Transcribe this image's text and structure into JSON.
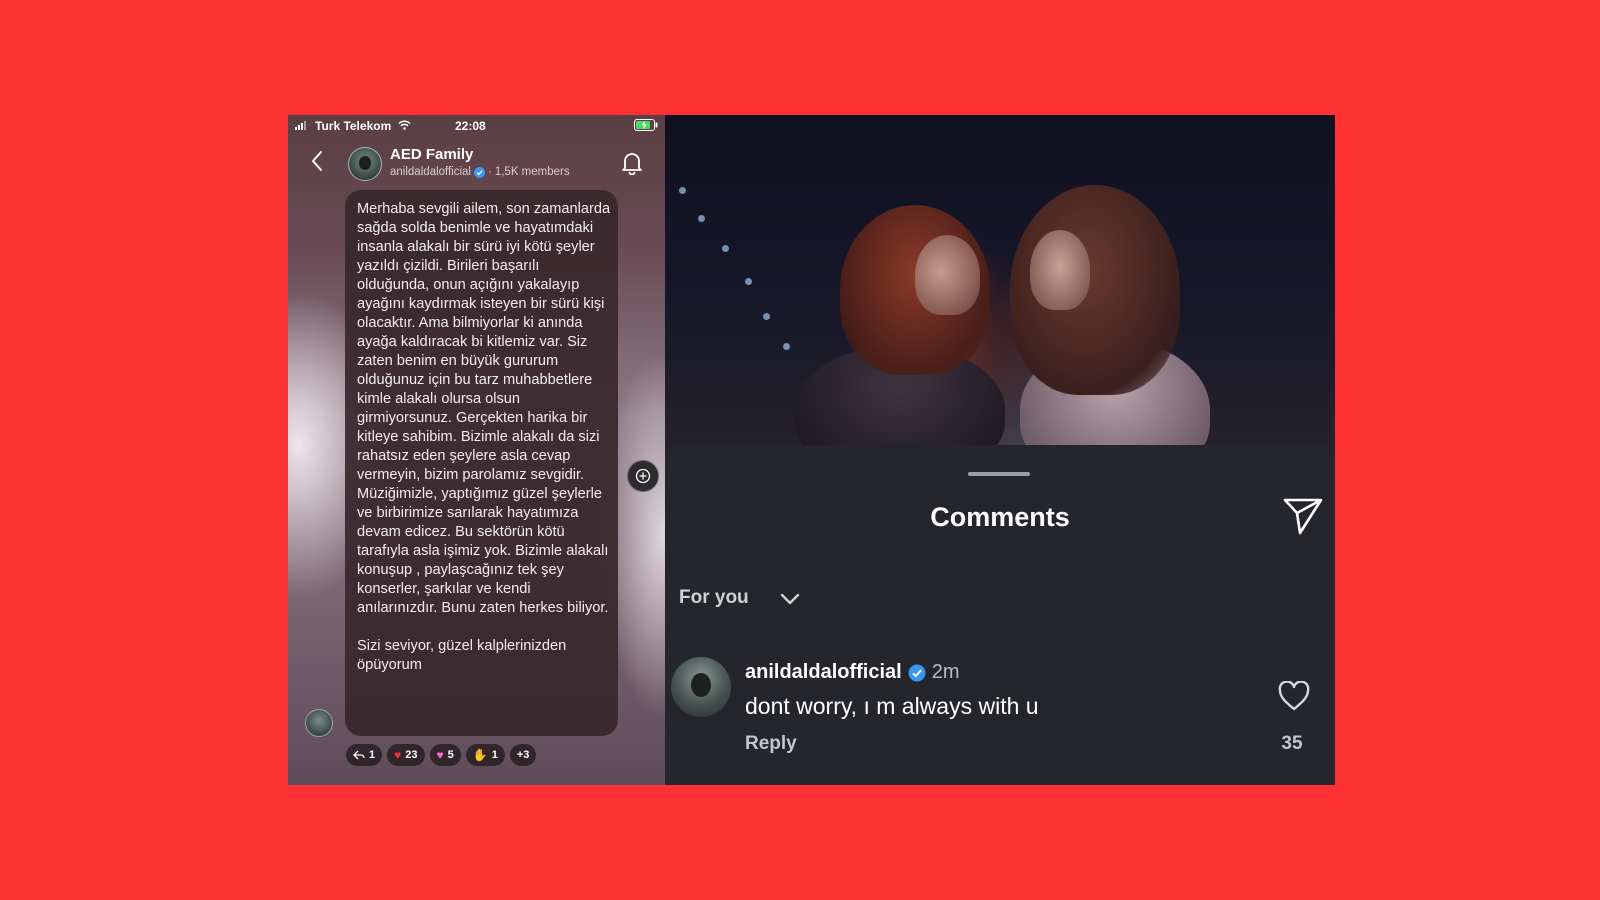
{
  "status_bar": {
    "carrier": "Turk Telekom",
    "time": "22:08"
  },
  "channel": {
    "name": "AED Family",
    "handle": "anildaldalofficial",
    "members": "1,5K members"
  },
  "message": {
    "body": "Merhaba sevgili ailem, son zamanlarda sağda solda benimle ve hayatımdaki insanla alakalı bir sürü iyi kötü şeyler yazıldı çizildi. Birileri başarılı olduğunda, onun açığını yakalayıp ayağını kaydırmak isteyen bir sürü kişi olacaktır. Ama bilmiyorlar ki anında ayağa kaldıracak bi kitlemiz var. Siz zaten benim en büyük gururum olduğunuz için bu tarz muhabbetlere kimle alakalı olursa olsun girmiyorsunuz. Gerçekten harika bir kitleye sahibim. Bizimle alakalı da sizi rahatsız eden şeylere asla cevap vermeyin, bizim parolamız sevgidir. Müziğimizle, yaptığımız güzel şeylerle ve birbirimize sarılarak hayatımıza devam edicez. Bu sektörün kötü tarafıyla asla işimiz yok. Bizimle alakalı konuşup , paylaşcağınız tek şey konserler, şarkılar ve kendi anılarınızdır. Bunu zaten herkes biliyor.\n\nSizi seviyor, güzel kalplerinizden öpüyorum",
    "reactions": {
      "replies": "1",
      "red_heart": "23",
      "pink_heart": "5",
      "hands": "1",
      "more": "+3"
    }
  },
  "comments_sheet": {
    "title": "Comments",
    "sort_label": "For you",
    "comment": {
      "username": "anildaldalofficial",
      "time": "2m",
      "text": "dont worry, ı m always with u",
      "reply_label": "Reply",
      "likes": "35"
    }
  },
  "colors": {
    "background": "#fd3033",
    "sheet": "#24262c",
    "verified": "#3897f0"
  }
}
